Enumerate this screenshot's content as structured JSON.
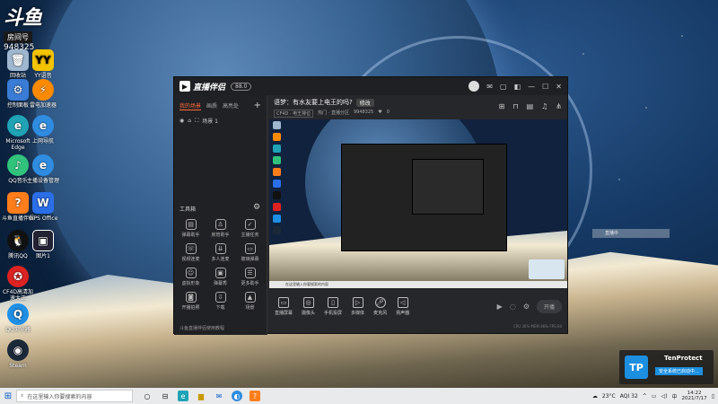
{
  "desktop": {
    "douyu": {
      "logo": "斗鱼",
      "room_label": "房间号",
      "room_number": "948325"
    },
    "icons": [
      {
        "label": "回收站"
      },
      {
        "label": "YY语音"
      },
      {
        "label": "控制面板"
      },
      {
        "label": "雷电加速器"
      },
      {
        "label": "Microsoft Edge"
      },
      {
        "label": "上网导航"
      },
      {
        "label": "QQ音乐"
      },
      {
        "label": "主播设备管理"
      },
      {
        "label": "斗鱼直播伴侣"
      },
      {
        "label": "WPS Office"
      },
      {
        "label": "腾讯QQ"
      },
      {
        "label": "图片1"
      },
      {
        "label": "CF4D高清加速大正"
      },
      {
        "label": "QQ浏览器"
      },
      {
        "label": "Steam"
      }
    ]
  },
  "app": {
    "name": "直播伴侣",
    "version_pill": "88.0",
    "left_tabs": [
      "我的场景",
      "画质",
      "高亮处"
    ],
    "scene_item": "场景 1",
    "tools_title": "工具箱",
    "tools": [
      {
        "label": "弹幕助手"
      },
      {
        "label": "房管助手"
      },
      {
        "label": "主播任务"
      },
      {
        "label": "视频连麦"
      },
      {
        "label": "多人连麦"
      },
      {
        "label": "玻璃弹幕"
      },
      {
        "label": "虚拟形象"
      },
      {
        "label": "弹幕秀"
      },
      {
        "label": "更多助手"
      },
      {
        "label": "开播拍照"
      },
      {
        "label": "下载"
      },
      {
        "label": "场景"
      }
    ],
    "left_footer": "斗鱼直播伴侣使用教程",
    "room": {
      "title": "语梦：有水友要上电王的吗?",
      "tag": "修改",
      "category": "CF4D · 电王排位",
      "meta": "热门 · 直播分区",
      "viewers": "9948325",
      "likes": "0"
    },
    "preview_taskbar_text": "在这里输入你要搜索的内容",
    "controls": [
      {
        "label": "直播屏幕"
      },
      {
        "label": "摄像头"
      },
      {
        "label": "手机投屏"
      },
      {
        "label": "多媒体"
      },
      {
        "label": "麦克风"
      },
      {
        "label": "扬声器"
      }
    ],
    "start_button": "开播",
    "status_text": "CPU 30%   MEM 46%   FPS 60"
  },
  "ghost_overlay": "直播中",
  "toast": {
    "logo": "TP",
    "title": "TenProtect",
    "subtitle": "安全系统已启动中..."
  },
  "taskbar": {
    "search_placeholder": "在这里输入你要搜索的内容",
    "weather": "23°C",
    "aqi": "AQI 32",
    "time": "14:22",
    "date": "2021/7/17"
  }
}
